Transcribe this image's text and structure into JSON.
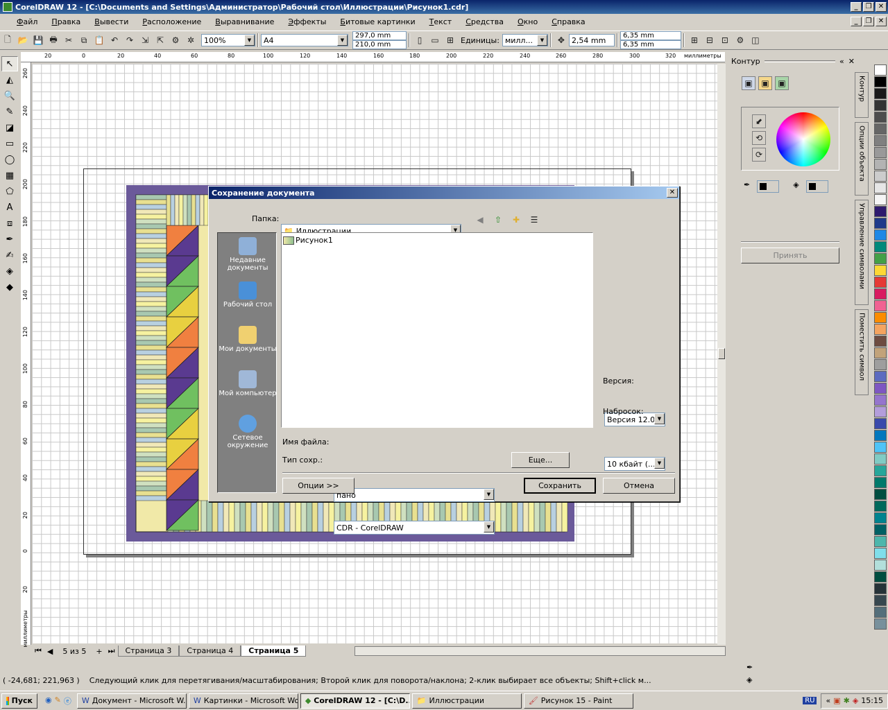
{
  "window": {
    "title": "CorelDRAW 12 - [C:\\Documents and Settings\\Администратор\\Рабочий стол\\Иллюстрации\\Рисунок1.cdr]"
  },
  "menu": [
    "Файл",
    "Правка",
    "Вывести",
    "Расположение",
    "Выравнивание",
    "Эффекты",
    "Битовые картинки",
    "Текст",
    "Средства",
    "Окно",
    "Справка"
  ],
  "toolbar": {
    "zoom": "100%",
    "paper": "A4",
    "width": "297,0 mm",
    "height": "210,0 mm",
    "units_label": "Единицы:",
    "units": "милл...",
    "nudge": "2,54 mm",
    "dup_x": "6,35 mm",
    "dup_y": "6,35 mm"
  },
  "ruler": {
    "h_ticks": [
      "20",
      "0",
      "20",
      "40",
      "60",
      "80",
      "100",
      "120",
      "140",
      "160",
      "180",
      "200",
      "220",
      "240",
      "260",
      "280",
      "300",
      "320",
      "миллиметры"
    ],
    "v_ticks": [
      "260",
      "240",
      "220",
      "200",
      "180",
      "160",
      "140",
      "120",
      "100",
      "80",
      "60",
      "40",
      "20",
      "0",
      "20",
      "миллиметры"
    ]
  },
  "pages": {
    "counter": "5 из 5",
    "tabs": [
      "Страница 3",
      "Страница 4",
      "Страница 5"
    ],
    "active": 2
  },
  "status": {
    "coords": "( -24,681; 221,963 )",
    "hint": "Следующий клик для перетягивания/масштабирования; Второй клик для поворота/наклона; 2-клик выбирает все объекты; Shift+click м..."
  },
  "docker": {
    "title": "Контур",
    "apply": "Принять",
    "tabs": [
      "Контур",
      "Опции объекта",
      "Управление символами",
      "Поместить символ"
    ]
  },
  "palette": [
    "#ffffff",
    "#000000",
    "#1a1a1a",
    "#333333",
    "#4d4d4d",
    "#666666",
    "#808080",
    "#999999",
    "#b3b3b3",
    "#cccccc",
    "#e6e6e6",
    "#f5f5f5",
    "#2e1a6e",
    "#1e3a8a",
    "#1e88e5",
    "#00897b",
    "#43a047",
    "#fdd835",
    "#e53935",
    "#d81b60",
    "#f06292",
    "#fb8c00",
    "#f4a460",
    "#6d4c41",
    "#c2a37a",
    "#9e9e9e",
    "#5c6bc0",
    "#7e57c2",
    "#9575cd",
    "#b39ddb",
    "#3949ab",
    "#0277bd",
    "#4fc3f7",
    "#80cbc4",
    "#26a69a",
    "#00796b",
    "#004d40",
    "#00695c",
    "#00838f",
    "#006064",
    "#4db6ac",
    "#80deea",
    "#b2dfdb",
    "#004d40",
    "#263238",
    "#37474f",
    "#546e7a",
    "#78909c"
  ],
  "dialog": {
    "title": "Сохранение документа",
    "folder_label": "Папка:",
    "folder": "Иллюстрации",
    "places": [
      {
        "label": "Недавние документы",
        "icon": "recent-docs-icon"
      },
      {
        "label": "Рабочий стол",
        "icon": "desktop-icon"
      },
      {
        "label": "Мои документы",
        "icon": "my-documents-icon"
      },
      {
        "label": "Мой компьютер",
        "icon": "my-computer-icon"
      },
      {
        "label": "Сетевое окружение",
        "icon": "network-icon"
      }
    ],
    "files": [
      "Рисунок1"
    ],
    "filename_label": "Имя файла:",
    "filename": "пано",
    "type_label": "Тип сохр.:",
    "type": "CDR - CorelDRAW",
    "more": "Еще...",
    "version_label": "Версия:",
    "version": "Версия 12.0",
    "thumb_label": "Набросок:",
    "thumb": "10 кбайт (...",
    "options": "Опции >>",
    "save": "Сохранить",
    "cancel": "Отмена"
  },
  "taskbar": {
    "start": "Пуск",
    "buttons": [
      "Документ - Microsoft W...",
      "Картинки - Microsoft Word",
      "CorelDRAW 12 - [C:\\D...",
      "Иллюстрации",
      "Рисунок 15 - Paint"
    ],
    "active": 2,
    "lang": "RU",
    "time": "15:15"
  }
}
